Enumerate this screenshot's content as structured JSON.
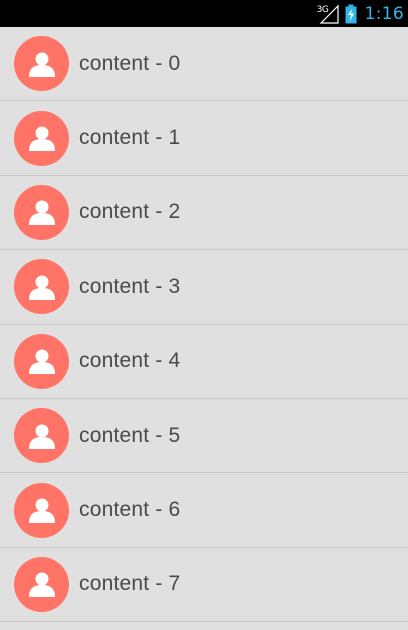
{
  "status_bar": {
    "network_type": "3G",
    "time": "1:16",
    "time_color": "#33b5e5",
    "icons": [
      "signal-icon",
      "battery-charging-icon"
    ]
  },
  "list": {
    "avatar_color": "#ff7466",
    "avatar_icon": "person-icon",
    "items": [
      {
        "label": "content - 0"
      },
      {
        "label": "content - 1"
      },
      {
        "label": "content - 2"
      },
      {
        "label": "content - 3"
      },
      {
        "label": "content - 4"
      },
      {
        "label": "content - 5"
      },
      {
        "label": "content - 6"
      },
      {
        "label": "content - 7"
      }
    ]
  }
}
